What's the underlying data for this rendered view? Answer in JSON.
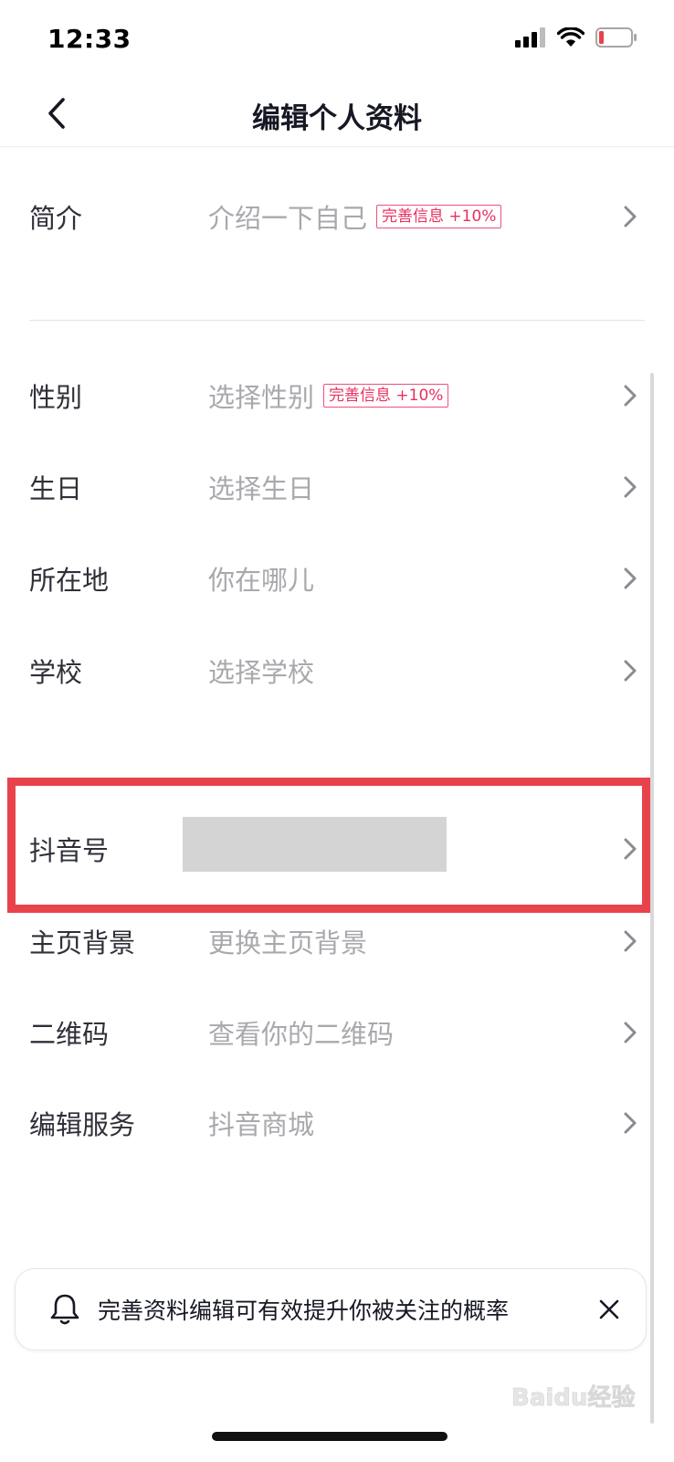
{
  "status_bar": {
    "time": "12:33"
  },
  "header": {
    "title": "编辑个人资料"
  },
  "rows": [
    {
      "id": "intro",
      "label": "简介",
      "value": "介绍一下自己",
      "badge": "完善信息 +10%"
    },
    {
      "id": "gender",
      "label": "性别",
      "value": "选择性别",
      "badge": "完善信息 +10%"
    },
    {
      "id": "birthday",
      "label": "生日",
      "value": "选择生日"
    },
    {
      "id": "location",
      "label": "所在地",
      "value": "你在哪儿"
    },
    {
      "id": "school",
      "label": "学校",
      "value": "选择学校"
    },
    {
      "id": "douyin-id",
      "label": "抖音号",
      "value": ""
    },
    {
      "id": "background",
      "label": "主页背景",
      "value": "更换主页背景"
    },
    {
      "id": "qrcode",
      "label": "二维码",
      "value": "查看你的二维码"
    },
    {
      "id": "service",
      "label": "编辑服务",
      "value": "抖音商城"
    }
  ],
  "tip": {
    "text": "完善资料编辑可有效提升你被关注的概率"
  },
  "colors": {
    "badge": "#e8305f",
    "highlight": "#e8434b",
    "placeholder": "#a8a9ad"
  },
  "watermark": {
    "text": "Baidu经验"
  }
}
